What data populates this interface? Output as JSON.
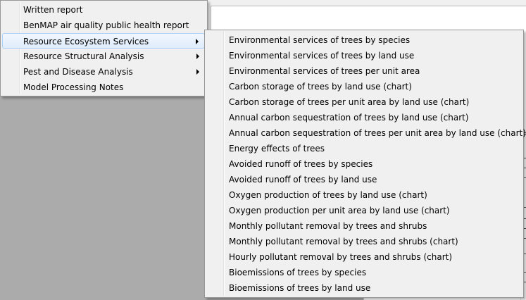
{
  "main_menu": {
    "items": [
      {
        "label": "Written report",
        "submenu": false
      },
      {
        "label": "BenMAP air quality public health report",
        "submenu": false
      },
      {
        "label": "Resource Ecosystem Services",
        "submenu": true,
        "highlighted": true
      },
      {
        "label": "Resource Structural Analysis",
        "submenu": true
      },
      {
        "label": "Pest and Disease Analysis",
        "submenu": true
      },
      {
        "label": "Model Processing Notes",
        "submenu": false
      }
    ]
  },
  "submenu": {
    "parent": "Resource Ecosystem Services",
    "items": [
      "Environmental services of trees by species",
      "Environmental services of trees by land use",
      "Environmental services of trees per unit area",
      "Carbon storage of trees by land use (chart)",
      "Carbon storage of trees per unit area by land use (chart)",
      "Annual carbon sequestration of trees by land use (chart)",
      "Annual carbon sequestration of trees per unit area by land use (chart)",
      "Energy effects of trees",
      "Avoided runoff of trees by species",
      "Avoided runoff of trees by land use",
      "Oxygen production of trees by land use (chart)",
      "Oxygen production per unit area by land use (chart)",
      "Monthly pollutant removal by trees and shrubs",
      "Monthly pollutant removal by trees and shrubs (chart)",
      "Hourly pollutant removal by trees and shrubs (chart)",
      "Bioemissions of trees by species",
      "Bioemissions of trees by land use"
    ]
  },
  "icons": {
    "submenu_arrow": "chevron-right-icon"
  },
  "colors": {
    "menu_background": "#f0f0f0",
    "highlight_border": "#aecff7",
    "desktop_background": "#ababab"
  }
}
